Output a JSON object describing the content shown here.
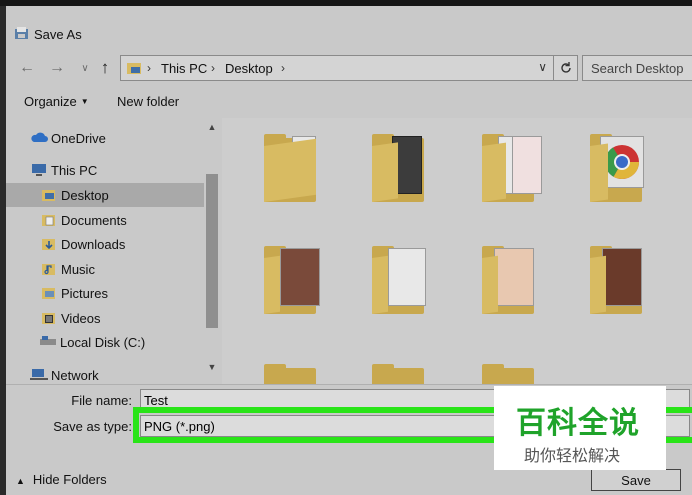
{
  "window": {
    "title": "Save As"
  },
  "nav": {
    "breadcrumb": [
      "This PC",
      "Desktop"
    ],
    "search_placeholder": "Search Desktop"
  },
  "toolbar": {
    "organize_label": "Organize",
    "new_folder_label": "New folder"
  },
  "sidebar": {
    "items": [
      {
        "label": "OneDrive",
        "icon": "cloud-icon"
      },
      {
        "label": "This PC",
        "icon": "computer-icon"
      },
      {
        "label": "Desktop",
        "icon": "desktop-folder-icon",
        "selected": true
      },
      {
        "label": "Documents",
        "icon": "documents-icon"
      },
      {
        "label": "Downloads",
        "icon": "downloads-icon"
      },
      {
        "label": "Music",
        "icon": "music-icon"
      },
      {
        "label": "Pictures",
        "icon": "pictures-icon"
      },
      {
        "label": "Videos",
        "icon": "videos-icon"
      },
      {
        "label": "Local Disk (C:)",
        "icon": "drive-icon"
      },
      {
        "label": "Network",
        "icon": "network-icon"
      }
    ]
  },
  "form": {
    "file_name_label": "File name:",
    "file_name_value": "Test",
    "save_type_label": "Save as type:",
    "save_type_value": "PNG (*.png)",
    "hide_folders_label": "Hide Folders",
    "save_label": "Save"
  },
  "watermark": {
    "brand": "百科全说",
    "tagline": "助你轻松解决"
  },
  "colors": {
    "highlight_box": "#29e418",
    "folder": "#d8bb62",
    "watermark_green": "#1fa32a"
  }
}
